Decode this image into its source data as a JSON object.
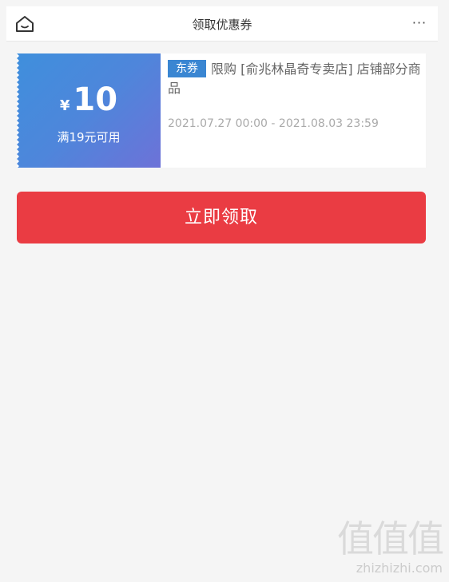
{
  "header": {
    "title": "领取优惠券",
    "home_icon": "home-icon",
    "more_icon": "more-icon",
    "more_glyph": "···"
  },
  "coupon": {
    "currency": "¥",
    "amount": "10",
    "threshold": "满19元可用",
    "tag": "东券",
    "description": "限购 [俞兆林晶奇专卖店] 店铺部分商品",
    "validity": "2021.07.27 00:00 - 2021.08.03 23:59",
    "colors": {
      "left_gradient_start": "#3f8fdc",
      "left_gradient_end": "#6d72d8",
      "tag_bg": "#3a86d2"
    }
  },
  "actions": {
    "claim_label": "立即领取",
    "claim_color": "#ea3c43"
  },
  "watermark": {
    "glyphs": "值值值",
    "url": "zhizhizhi.com"
  }
}
